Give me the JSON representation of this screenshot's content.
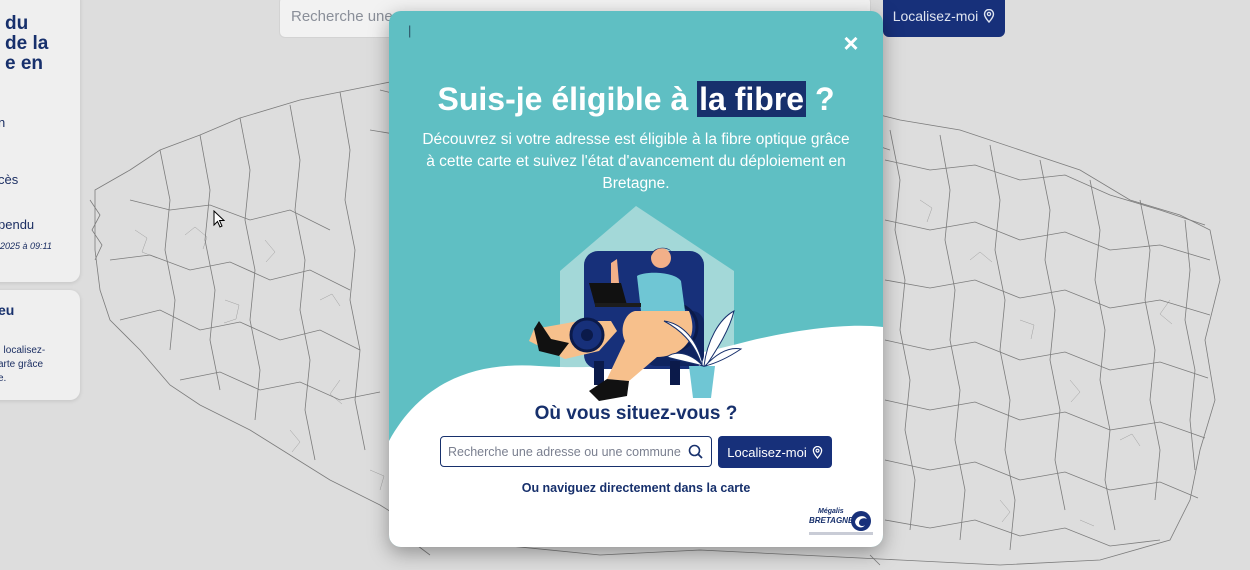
{
  "left_panel": {
    "title_lines": [
      "du",
      "de la",
      "e en"
    ],
    "items": [
      "n",
      "cès",
      "pendu"
    ],
    "date": "2025 à 09:11"
  },
  "left_panel2": {
    "title": "eu",
    "lines": [
      ", localisez-",
      "arte grâce",
      "e."
    ]
  },
  "top_bar": {
    "search_placeholder": "Recherche une",
    "locate_label": "Localisez-moi"
  },
  "modal": {
    "close_symbol": "×",
    "caret": "|",
    "title_before": "Suis-je éligible à ",
    "title_highlight": "la fibre",
    "title_after": " ?",
    "description": "Découvrez si votre adresse est éligible à la fibre optique grâce à cette carte et suivez l'état d'avancement du déploiement en Bretagne.",
    "where_title": "Où vous situez-vous ?",
    "search_placeholder": "Recherche une adresse ou une commune",
    "locate_label": "Localisez-moi",
    "navigate_link": "Ou naviguez directement dans la carte",
    "logo_line1": "Mégalis",
    "logo_line2": "BRETAGNE"
  },
  "icons": {
    "search": "search-icon",
    "location": "location-pin-icon",
    "close": "close-icon"
  },
  "colors": {
    "modal_bg": "#5fbfc3",
    "navy": "#17306c",
    "button": "#17307a",
    "map_bg": "#e7e7e7"
  }
}
